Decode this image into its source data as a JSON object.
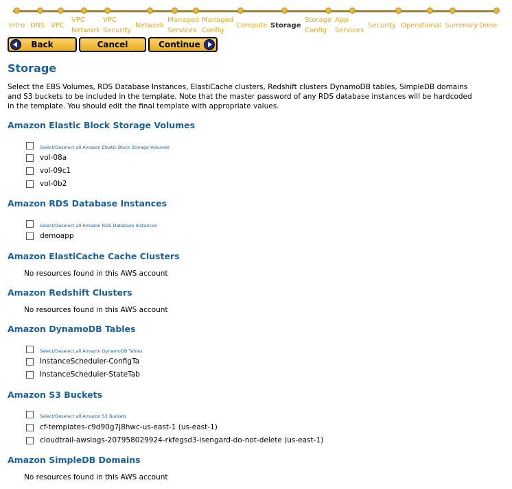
{
  "wizard": {
    "steps": [
      {
        "label": "Intro",
        "lines": [
          "Intro"
        ]
      },
      {
        "label": "DNS",
        "lines": [
          "DNS"
        ]
      },
      {
        "label": "VPC",
        "lines": [
          "VPC"
        ]
      },
      {
        "label": "VPC Network",
        "lines": [
          "VPC",
          "Network"
        ]
      },
      {
        "label": "VPC Security",
        "lines": [
          "VPC",
          "Security"
        ]
      },
      {
        "label": "Network",
        "lines": [
          "Network"
        ]
      },
      {
        "label": "Managed Services",
        "lines": [
          "Managed",
          "Services"
        ]
      },
      {
        "label": "Managed Config",
        "lines": [
          "Managed",
          "Config"
        ]
      },
      {
        "label": "Compute",
        "lines": [
          "Compute"
        ]
      },
      {
        "label": "Storage",
        "lines": [
          "Storage"
        ],
        "current": true
      },
      {
        "label": "Storage Config",
        "lines": [
          "Storage",
          "Config"
        ]
      },
      {
        "label": "App Services",
        "lines": [
          "App",
          "Services"
        ]
      },
      {
        "label": "Security",
        "lines": [
          "Security"
        ]
      },
      {
        "label": "Operational",
        "lines": [
          "Operational"
        ]
      },
      {
        "label": "Summary",
        "lines": [
          "Summary"
        ]
      },
      {
        "label": "Done",
        "lines": [
          "Done"
        ]
      }
    ]
  },
  "buttons": {
    "back": "Back",
    "cancel": "Cancel",
    "continue": "Continue"
  },
  "page": {
    "title": "Storage",
    "intro_lines": [
      "Select the EBS Volumes, RDS Database Instances, ElastiCache clusters, Redshift clusters DynamoDB tables, SimpleDB domains",
      "and S3 buckets to be included in the template. Note that the master password of any RDS database instances will be hardcoded",
      "in the template. You should edit the final template with appropriate values."
    ]
  },
  "sections": {
    "ebs": {
      "title": "Amazon Elastic Block Storage Volumes",
      "select_all": "Select/Deselect all Amazon Elastic Block Storage Volumes",
      "items": [
        "vol-08a",
        "vol-09c1",
        "vol-0b2"
      ]
    },
    "rds": {
      "title": "Amazon RDS Database Instances",
      "select_all": "Select/Deselect all Amazon RDS Database Instances",
      "items": [
        "demoapp"
      ]
    },
    "elasticache": {
      "title": "Amazon ElastiCache Cache Clusters",
      "empty": "No resources found in this AWS account"
    },
    "redshift": {
      "title": "Amazon Redshift Clusters",
      "empty": "No resources found in this AWS account"
    },
    "dynamodb": {
      "title": "Amazon DynamoDB Tables",
      "select_all": "Select/Deselect all Amazon DynamoDB Tables",
      "items": [
        "InstanceScheduler-ConfigTa",
        "InstanceScheduler-StateTab"
      ]
    },
    "s3": {
      "title": "Amazon S3 Buckets",
      "select_all": "Select/Deselect all Amazon S3 Buckets",
      "items": [
        "cf-templates-c9d90g7j8hwc-us-east-1 (us-east-1)",
        "cloudtrail-awslogs-207958029924-rkfegsd3-isengard-do-not-delete (us-east-1)"
      ]
    },
    "simpledb": {
      "title": "Amazon SimpleDB Domains",
      "empty": "No resources found in this AWS account"
    }
  },
  "colors": {
    "accent": "#1a5f98",
    "wizard": "#e0a820",
    "button": "#f4c040"
  }
}
